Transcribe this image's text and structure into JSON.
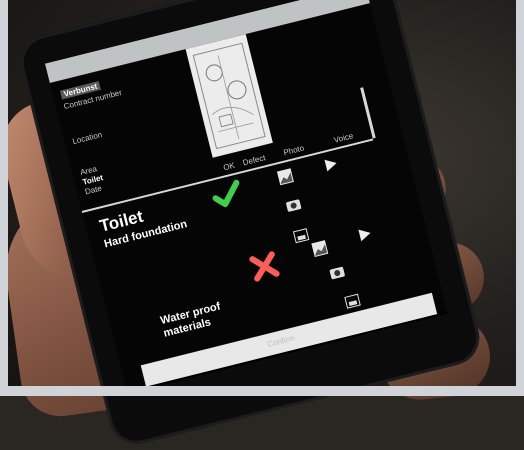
{
  "screen": {
    "header_item": "Verbunst",
    "fields": {
      "contract_number": "Contract number",
      "location": "Location",
      "area": "Area",
      "area_value": "Toilet",
      "date": "Date"
    },
    "columns": [
      "OK",
      "Defect",
      "Photo",
      "Voice"
    ],
    "sections": [
      {
        "title": "Toilet",
        "item": "Hard foundation",
        "status": "ok"
      },
      {
        "item": "Water proof materials",
        "status": "defect"
      }
    ],
    "footer_button": "Confirm"
  },
  "colors": {
    "ok": "#3fcf4a",
    "defect": "#ff5e56",
    "ui_light": "#d8d8d8"
  },
  "icons": [
    "check-icon",
    "cross-icon",
    "photo-icon",
    "camera-icon",
    "play-icon",
    "image-icon",
    "back-icon",
    "recent-apps-icon",
    "menu-icon"
  ]
}
